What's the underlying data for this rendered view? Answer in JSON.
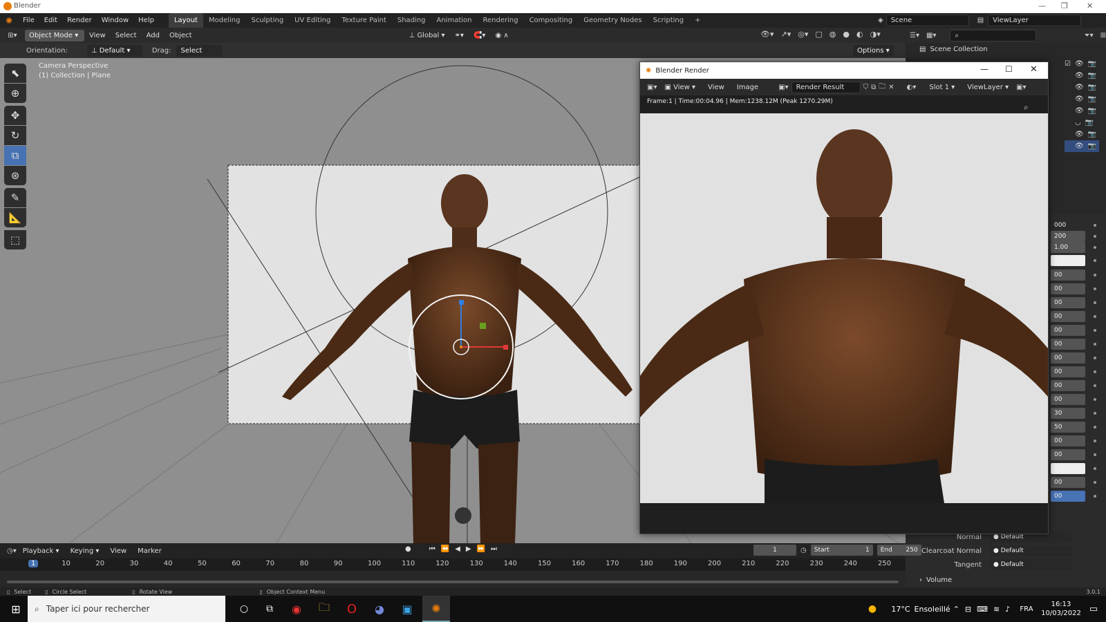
{
  "window": {
    "title": "Blender"
  },
  "menubar": {
    "items": [
      "File",
      "Edit",
      "Render",
      "Window",
      "Help"
    ],
    "workspaces": [
      "Layout",
      "Modeling",
      "Sculpting",
      "UV Editing",
      "Texture Paint",
      "Shading",
      "Animation",
      "Rendering",
      "Compositing",
      "Geometry Nodes",
      "Scripting"
    ],
    "plus": "+",
    "scene": "Scene",
    "view_layer": "ViewLayer"
  },
  "header": {
    "mode": "Object Mode",
    "menus": [
      "View",
      "Select",
      "Add",
      "Object"
    ],
    "transform_orientation": "Global"
  },
  "toolsettings": {
    "orientation_label": "Orientation:",
    "orientation_value": "Default",
    "drag_label": "Drag:",
    "drag_value": "Select Circ...",
    "options": "Options"
  },
  "viewport": {
    "line1": "Camera Perspective",
    "line2": "(1) Collection | Plane"
  },
  "render_window": {
    "title": "Blender Render",
    "menus": [
      "View",
      "View",
      "Image"
    ],
    "image": "Render Result",
    "slot": "Slot 1",
    "view_layer": "ViewLayer",
    "info": "Frame:1 | Time:00:04.96 | Mem:1238.12M (Peak 1270.29M)"
  },
  "outliner": {
    "scene_collection": "Scene Collection",
    "partial": "Collection"
  },
  "properties": {
    "rows": [
      "Normal",
      "Clearcoat Normal",
      "Tangent"
    ],
    "values": [
      "Default",
      "Default",
      "Default"
    ],
    "section": "Volume",
    "partial_values": [
      "000",
      "200",
      "1.00",
      "00",
      "00",
      "00",
      "00",
      "00",
      "00",
      "00",
      "00",
      "00",
      "00",
      "30",
      "50",
      "00",
      "00",
      "00",
      "00"
    ]
  },
  "timeline": {
    "menus": [
      "Playback",
      "Keying",
      "View",
      "Marker"
    ],
    "current_frame": "1",
    "start_label": "Start",
    "start": "1",
    "end_label": "End",
    "end": "250",
    "ticks": [
      "1",
      "10",
      "20",
      "30",
      "40",
      "50",
      "60",
      "70",
      "80",
      "90",
      "100",
      "110",
      "120",
      "130",
      "140",
      "150",
      "160",
      "170",
      "180",
      "190",
      "200",
      "210",
      "220",
      "230",
      "240",
      "250"
    ]
  },
  "statusbar": {
    "select": "Select",
    "circle_select": "Circle Select",
    "rotate_view": "Rotate View",
    "context_menu": "Object Context Menu",
    "version": "3.0.1"
  },
  "taskbar": {
    "search": "Taper ici pour rechercher",
    "temp": "17°C",
    "weather": "Ensoleillé",
    "lang": "FRA",
    "time": "16:13",
    "date": "10/03/2022"
  },
  "colors": {
    "accent": "#4772b3",
    "active_frame": "#4772b3",
    "orange": "#e87d0d"
  }
}
